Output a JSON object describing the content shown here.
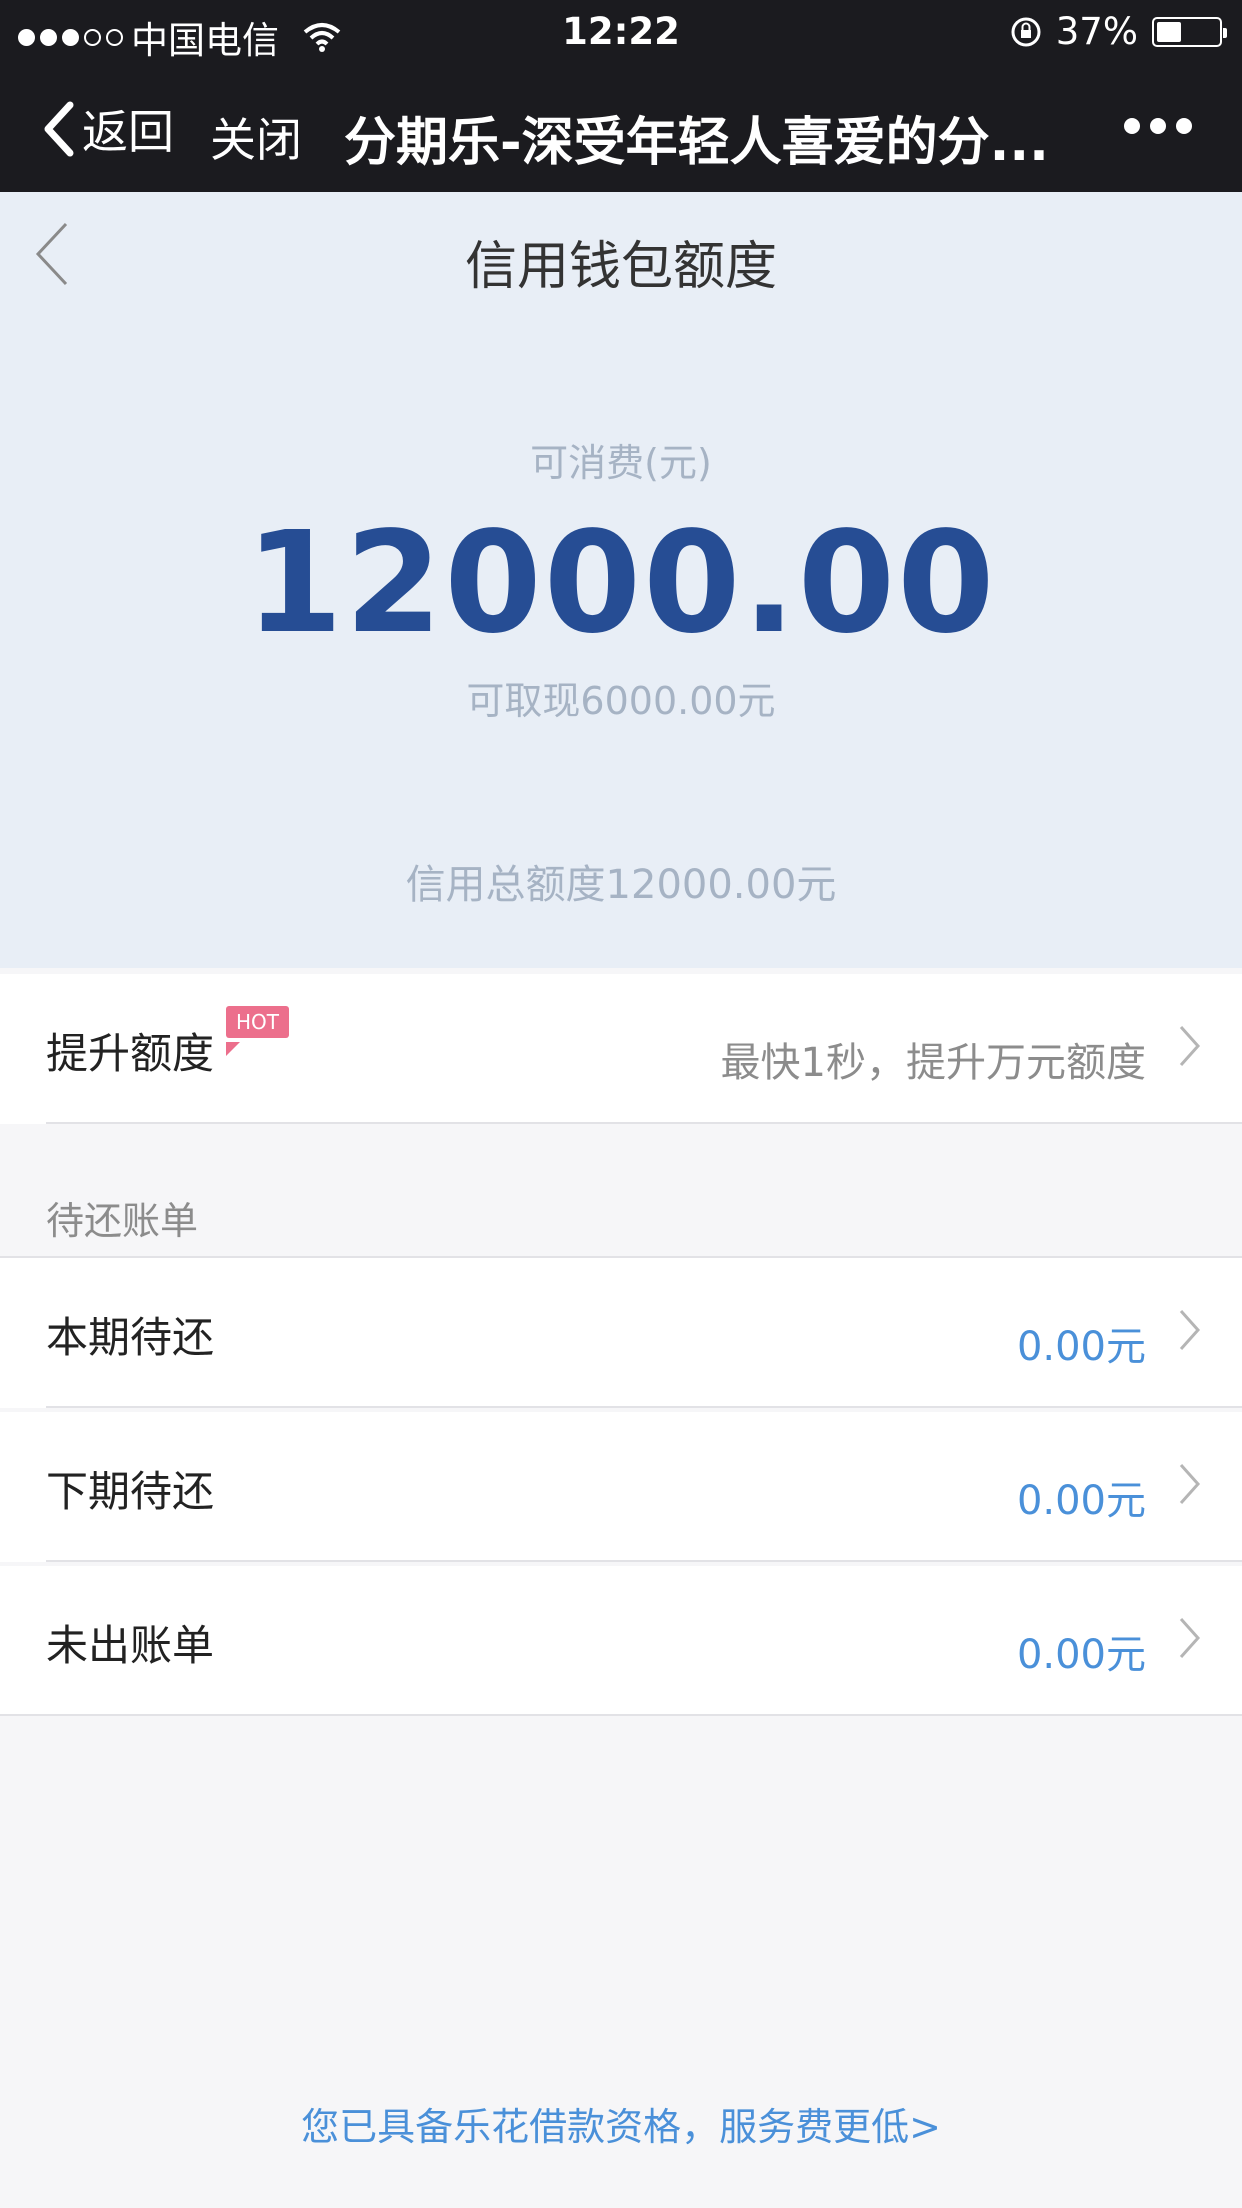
{
  "status_bar": {
    "carrier": "中国电信",
    "time": "12:22",
    "battery": "37%",
    "battery_level": 0.37
  },
  "nav": {
    "back_label": "返回",
    "close_label": "关闭",
    "title": "分期乐-深受年轻人喜爱的分..."
  },
  "summary": {
    "title": "信用钱包额度",
    "available_label": "可消费(元)",
    "available_amount": "12000.00",
    "cash_text": "可取现6000.00元",
    "total_text": "信用总额度12000.00元"
  },
  "boost": {
    "label": "提升额度",
    "badge": "HOT",
    "desc": "最快1秒，提升万元额度"
  },
  "bills": {
    "section_label": "待还账单",
    "items": [
      {
        "label": "本期待还",
        "value": "0.00元"
      },
      {
        "label": "下期待还",
        "value": "0.00元"
      },
      {
        "label": "未出账单",
        "value": "0.00元"
      }
    ]
  },
  "footer": {
    "link_text": "您已具备乐花借款资格，服务费更低>"
  },
  "colors": {
    "accent_blue": "#264d94",
    "link_blue": "#4a90d9",
    "hot_pink": "#ec6f8c"
  }
}
